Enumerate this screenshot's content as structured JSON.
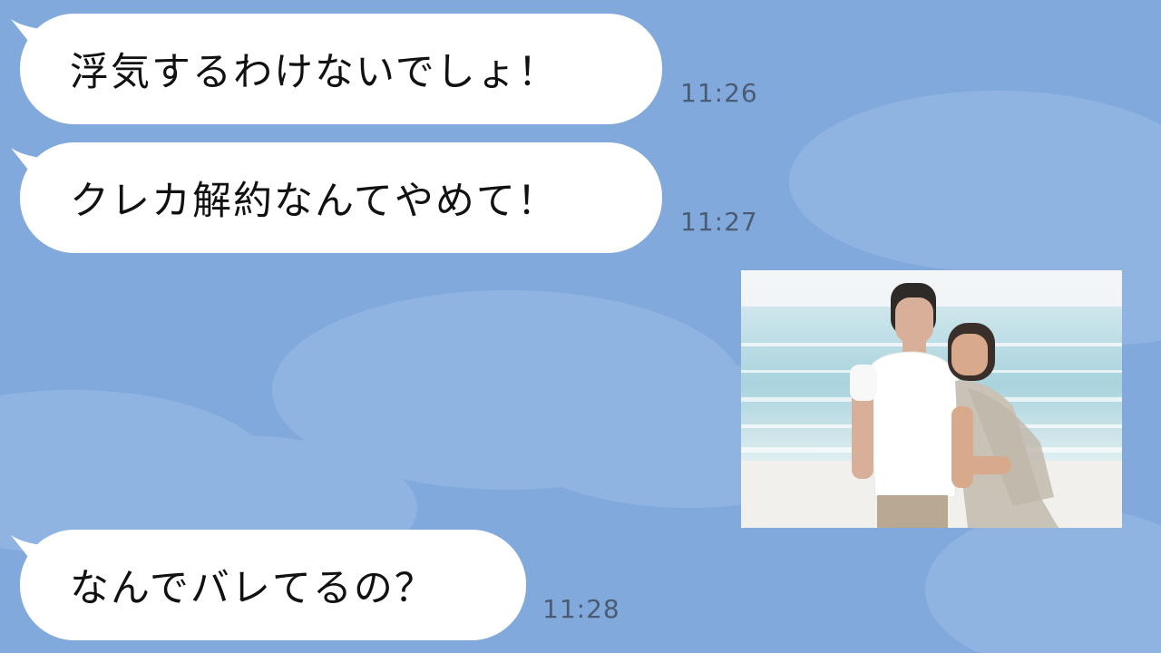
{
  "chat": {
    "messages": [
      {
        "text": "浮気するわけないでしょ！",
        "time": "11:26"
      },
      {
        "text": "クレカ解約なんてやめて！",
        "time": "11:27"
      },
      {
        "text": "なんでバレてるの？",
        "time": "11:28"
      }
    ],
    "photo": {
      "icon": "couple-beach-photo"
    }
  },
  "colors": {
    "background": "#82a9dc",
    "bubble": "#ffffff",
    "timestamp": "#4a5c74"
  }
}
